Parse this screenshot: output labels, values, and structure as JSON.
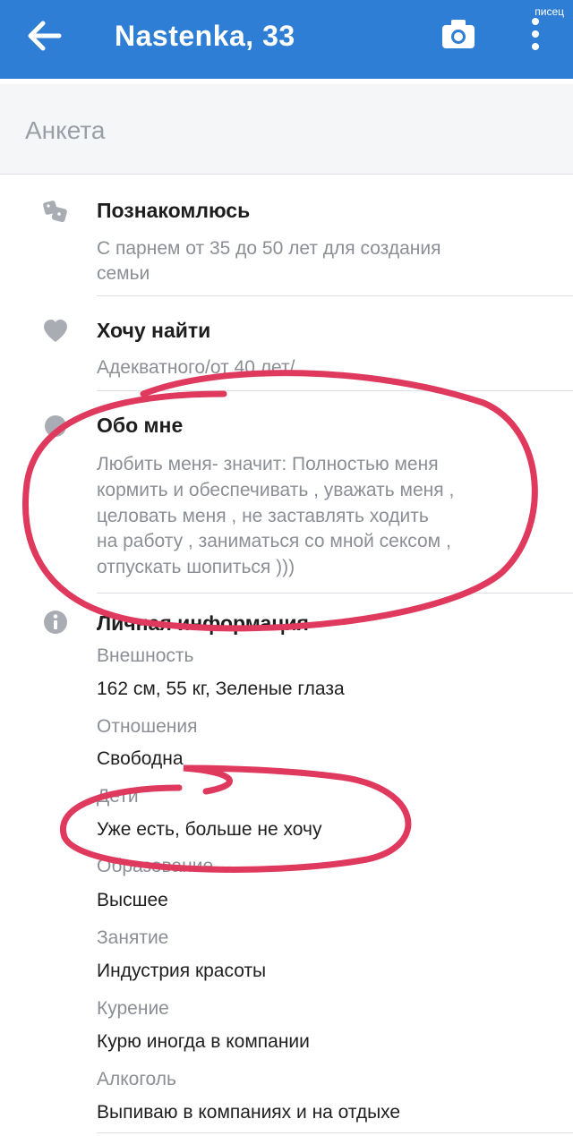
{
  "header": {
    "title": "Nastenka, 33",
    "watermark": "писец",
    "back_icon": "arrow-left-icon",
    "camera_icon": "camera-icon",
    "more_icon": "more-vertical-icon"
  },
  "section": {
    "title": "Анкета"
  },
  "blocks": {
    "meet": {
      "icon": "dice-icon",
      "title": "Познакомлюсь",
      "lines": [
        "С парнем от 35 до 50 лет для создания",
        "семьи"
      ]
    },
    "want": {
      "icon": "heart-icon",
      "title": "Хочу найти",
      "text": "Адекватного/от 40 лет/"
    },
    "about": {
      "icon": "circle-icon",
      "title": "Обо мне",
      "lines": [
        "Любить меня- значит: Полностью меня",
        "кормить и обеспечивать , уважать меня ,",
        "целовать меня , не заставлять ходить",
        "на работу , заниматься со мной сексом  ,",
        "отпускать шопиться )))"
      ]
    },
    "personal": {
      "icon": "info-icon",
      "title": "Личная информация",
      "fields": [
        {
          "label": "Внешность",
          "value": "162 см, 55 кг, Зеленые глаза"
        },
        {
          "label": "Отношения",
          "value": "Свободна"
        },
        {
          "label": "Дети",
          "value": "Уже есть, больше не хочу"
        },
        {
          "label": "Образование",
          "value": "Высшее"
        },
        {
          "label": "Занятие",
          "value": "Индустрия красоты"
        },
        {
          "label": "Курение",
          "value": "Курю иногда в компании"
        },
        {
          "label": "Алкоголь",
          "value": "Выпиваю в компаниях и на отдыхе"
        }
      ]
    }
  },
  "colors": {
    "appbar": "#2f7ed6",
    "marker": "#e0395e"
  }
}
